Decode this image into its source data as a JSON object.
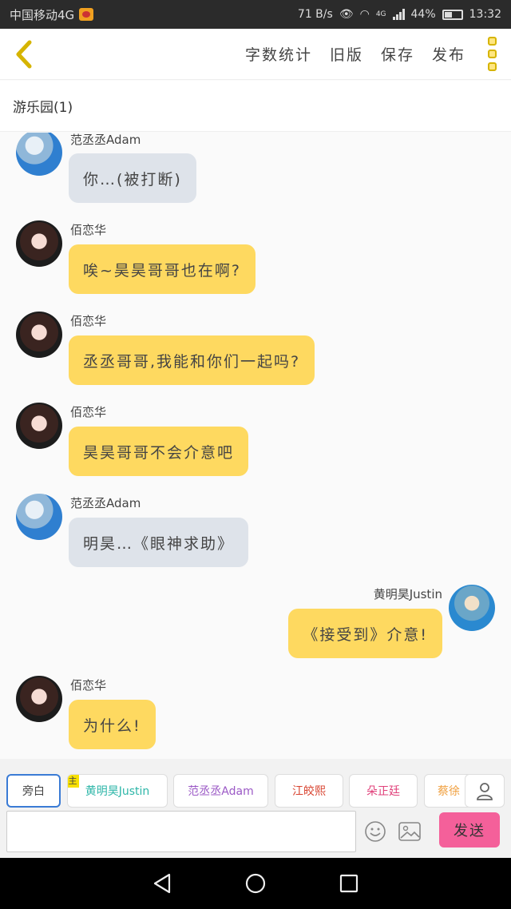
{
  "status_bar": {
    "carrier": "中国移动4G",
    "speed": "71 B/s",
    "network": "4G",
    "battery": "44%",
    "battery_level": 0.44,
    "time": "13:32"
  },
  "header": {
    "actions": [
      "字数统计",
      "旧版",
      "保存",
      "发布"
    ]
  },
  "subheader": {
    "title": "游乐园(1)"
  },
  "messages": [
    {
      "sender": "范丞丞Adam",
      "text": "你…(被打断)",
      "side": "left",
      "style": "grey",
      "avatar": "adam"
    },
    {
      "sender": "佰恋华",
      "text": "唉~昊昊哥哥也在啊?",
      "side": "left",
      "style": "yellow",
      "avatar": "hua"
    },
    {
      "sender": "佰恋华",
      "text": "丞丞哥哥,我能和你们一起吗?",
      "side": "left",
      "style": "yellow",
      "avatar": "hua"
    },
    {
      "sender": "佰恋华",
      "text": "昊昊哥哥不会介意吧",
      "side": "left",
      "style": "yellow",
      "avatar": "hua"
    },
    {
      "sender": "范丞丞Adam",
      "text": "明昊…《眼神求助》",
      "side": "left",
      "style": "grey",
      "avatar": "adam"
    },
    {
      "sender": "黄明昊Justin",
      "text": "《接受到》介意!",
      "side": "right",
      "style": "yellow",
      "avatar": "justin"
    },
    {
      "sender": "佰恋华",
      "text": "为什么!",
      "side": "left",
      "style": "yellow",
      "avatar": "hua"
    }
  ],
  "roles": [
    {
      "label": "旁白",
      "color": "#444444",
      "selected": true
    },
    {
      "label": "黄明昊Justin",
      "color": "#2db6a8",
      "badge": "主"
    },
    {
      "label": "范丞丞Adam",
      "color": "#9b59c6"
    },
    {
      "label": "江皎熙",
      "color": "#d8432f"
    },
    {
      "label": "朵正廷",
      "color": "#e0407a"
    },
    {
      "label": "蔡徐",
      "color": "#f0a040"
    }
  ],
  "input": {
    "placeholder": "",
    "send_label": "发送"
  },
  "colors": {
    "accent": "#fed960",
    "send": "#f4609a",
    "grey_bubble": "#dee3ea"
  }
}
